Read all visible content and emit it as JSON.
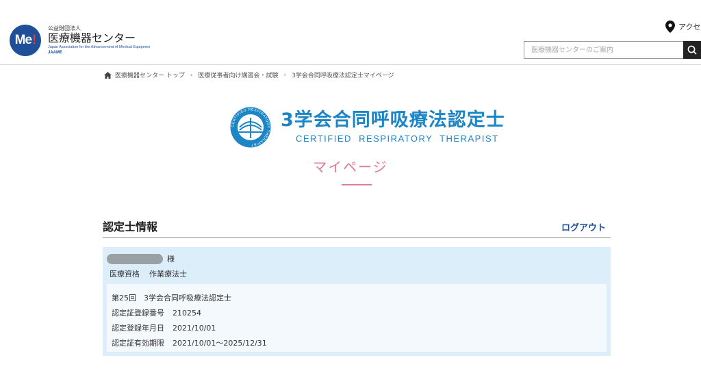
{
  "header": {
    "logo_mark": "Me",
    "logo_mark_bang": "!",
    "logo_sub": "公益財団法人",
    "logo_main": "医療機器センター",
    "logo_en": "Japan Association for the Advancement of Medical Equipmen",
    "logo_abbr": "JAAME",
    "access_label": "アクセス",
    "search_placeholder": "医療機器センターのご案内"
  },
  "breadcrumb": [
    "医療機器センター トップ",
    "医療従事者向け講習会・試験",
    "3学会合同呼吸療法認定士マイページ"
  ],
  "brand": {
    "title_jp": "3学会合同呼吸療法認定士",
    "title_en": "CERTIFIED  RESPIRATORY  THERAPIST",
    "emblem_text": "CERTIFIED RESPIRATORY THERAPIST"
  },
  "page_title": "マイページ",
  "section": {
    "title": "認定士情報",
    "logout_label": "ログアウト"
  },
  "profile": {
    "honorific": "様",
    "qualification_label": "医療資格",
    "qualification_value": "作業療法士"
  },
  "certificate": {
    "session": "第25回　3学会合同呼吸療法認定士",
    "reg_number_label": "認定証登録番号",
    "reg_number_value": "210254",
    "reg_date_label": "認定登録年月日",
    "reg_date_value": "2021/10/01",
    "validity_label": "認定証有効期限",
    "validity_value": "2021/10/01～2025/12/31"
  },
  "colors": {
    "brand_blue": "#1b85c6",
    "navy": "#1f4f99",
    "pink": "#e07a95",
    "card_bg": "#ddeefb"
  }
}
